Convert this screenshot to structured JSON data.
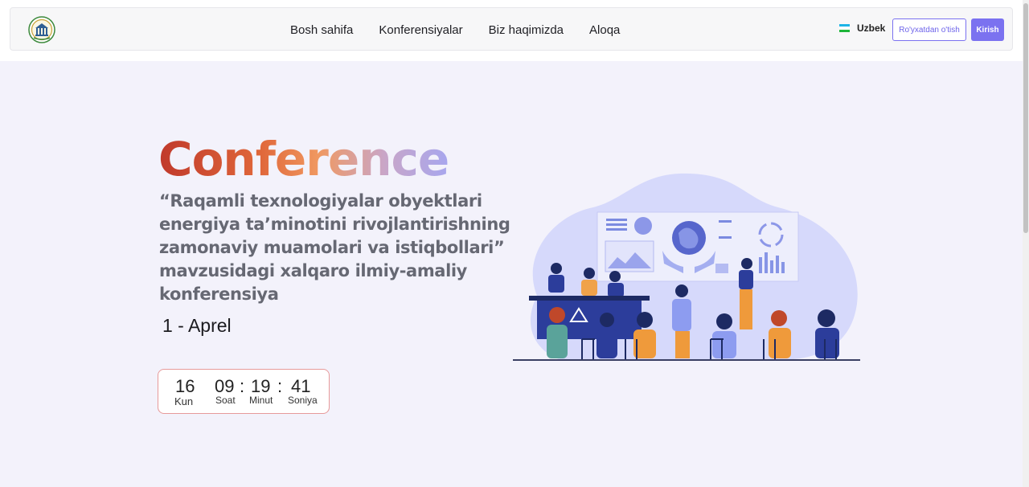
{
  "nav": {
    "links": [
      "Bosh sahifa",
      "Konferensiyalar",
      "Biz haqimizda",
      "Aloqa"
    ],
    "language": "Uzbek",
    "register_label": "Ro'yxatdan o'tish",
    "login_label": "Kirish"
  },
  "hero": {
    "title": "Conference",
    "subtitle_lines": [
      "“Raqamli texnologiyalar obyektlari",
      "energiya ta’minotini rivojlantirishning",
      "zamonaviy muamolari va istiqbollari”",
      "mavzusidagi xalqaro ilmiy-amaliy",
      "konferensiya"
    ],
    "date": "1 - Aprel"
  },
  "countdown": {
    "days": "16",
    "days_label": "Kun",
    "hours": "09",
    "hours_label": "Soat",
    "minutes": "19",
    "minutes_label": "Minut",
    "seconds": "41",
    "seconds_label": "Soniya",
    "separator": ":"
  },
  "colors": {
    "accent": "#7b72f0",
    "page_background": "#f3f2fb",
    "title_gradient": [
      "#c0392b",
      "#e0673a",
      "#f09860",
      "#c9a6c8",
      "#a7a6ee"
    ],
    "flag": [
      "#1eb4e6",
      "#ffffff",
      "#1eb53a"
    ]
  }
}
